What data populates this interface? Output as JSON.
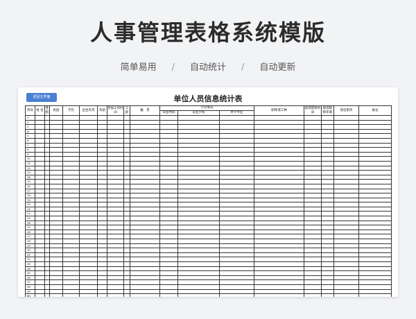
{
  "page": {
    "title": "人事管理表格系统模版",
    "features": [
      "简单易用",
      "自动统计",
      "自动更新"
    ],
    "separator": "/"
  },
  "sheet": {
    "back_button": "返回主界面",
    "title": "单位人员信息统计表",
    "headers": {
      "seq": "序号",
      "name": "姓 名",
      "gender": "性别",
      "ethnicity": "民族",
      "education": "学历",
      "birth": "出生年月",
      "age": "年龄",
      "work_start": "参加工作时间",
      "seniority": "工龄",
      "origin": "籍　贯",
      "edu_group": "学历情况",
      "grad_time": "毕业时间",
      "school": "毕业学校",
      "major": "所学专业",
      "title_type": "职称或工种",
      "title_time": "取得职称时间",
      "title_years": "取得职称年限",
      "current_post": "现任职务",
      "remarks": "备注"
    },
    "row_numbers": [
      "1",
      "2",
      "3",
      "4",
      "5",
      "6",
      "7",
      "8",
      "9",
      "10",
      "11",
      "12",
      "13",
      "14",
      "15",
      "16",
      "17",
      "18",
      "19",
      "20",
      "21",
      "22",
      "23",
      "24",
      "25",
      "26",
      "27",
      "28",
      "29",
      "30",
      "31",
      "32",
      "33",
      "34",
      "35",
      "36",
      "37",
      "38",
      "39",
      "40",
      "41",
      "42",
      "43",
      "44",
      "45",
      "46"
    ]
  }
}
